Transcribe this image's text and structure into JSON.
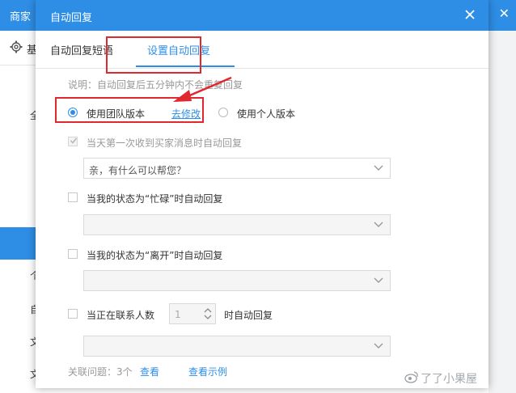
{
  "background": {
    "app_title": "商家",
    "close_symbol": "✕",
    "gear_label": "基",
    "side_chars": [
      "全",
      "个",
      "自",
      "文",
      "文"
    ]
  },
  "dialog": {
    "title": "自动回复",
    "tabs": [
      {
        "label": "自动回复短语"
      },
      {
        "label": "设置自动回复"
      }
    ],
    "note": "说明：自动回复后五分钟内不会重复回复",
    "version": {
      "team_label": "使用团队版本",
      "modify_link": "去修改",
      "personal_label": "使用个人版本"
    },
    "options": [
      {
        "label": "当天第一次收到买家消息时自动回复",
        "checked": true,
        "select_value": "亲，有什么可以帮您？"
      },
      {
        "label": "当我的状态为“忙碌”时自动回复",
        "checked": false,
        "select_value": ""
      },
      {
        "label": "当我的状态为“离开”时自动回复",
        "checked": false,
        "select_value": ""
      },
      {
        "label_prefix": "当正在联系人数",
        "stepper_value": "1",
        "label_suffix": "时自动回复",
        "checked": false,
        "select_value": ""
      }
    ],
    "footer": {
      "related_label": "关联问题：3个",
      "view_link": "查看",
      "example_link": "查看示例"
    }
  },
  "watermark": "了了小果屋",
  "colors": {
    "primary": "#2e8ee5",
    "highlight": "#e0282e"
  }
}
